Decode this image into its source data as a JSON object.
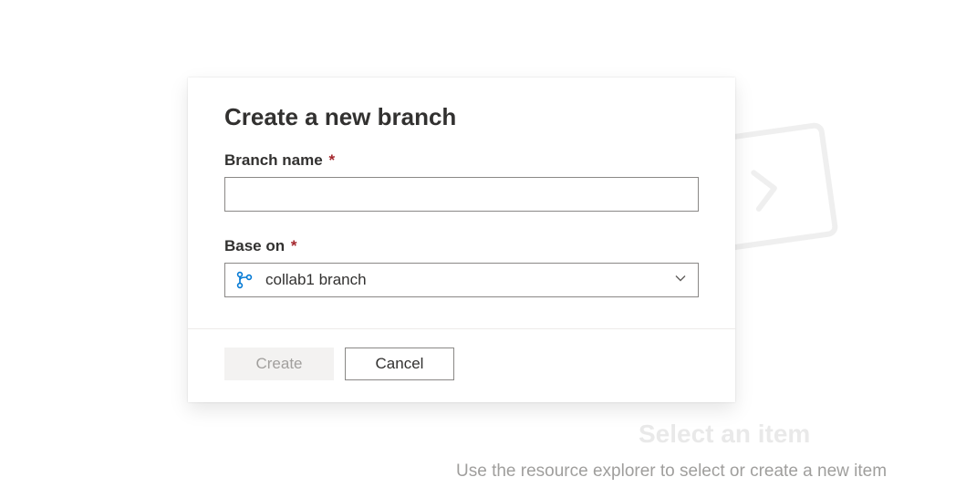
{
  "background": {
    "heading": "Select an item",
    "subtext": "Use the resource explorer to select or create a new item"
  },
  "modal": {
    "title": "Create a new branch",
    "branch_name": {
      "label": "Branch name",
      "required_mark": "*",
      "value": "",
      "placeholder": ""
    },
    "base_on": {
      "label": "Base on",
      "required_mark": "*",
      "selected": "collab1 branch"
    },
    "buttons": {
      "create": "Create",
      "cancel": "Cancel"
    }
  }
}
